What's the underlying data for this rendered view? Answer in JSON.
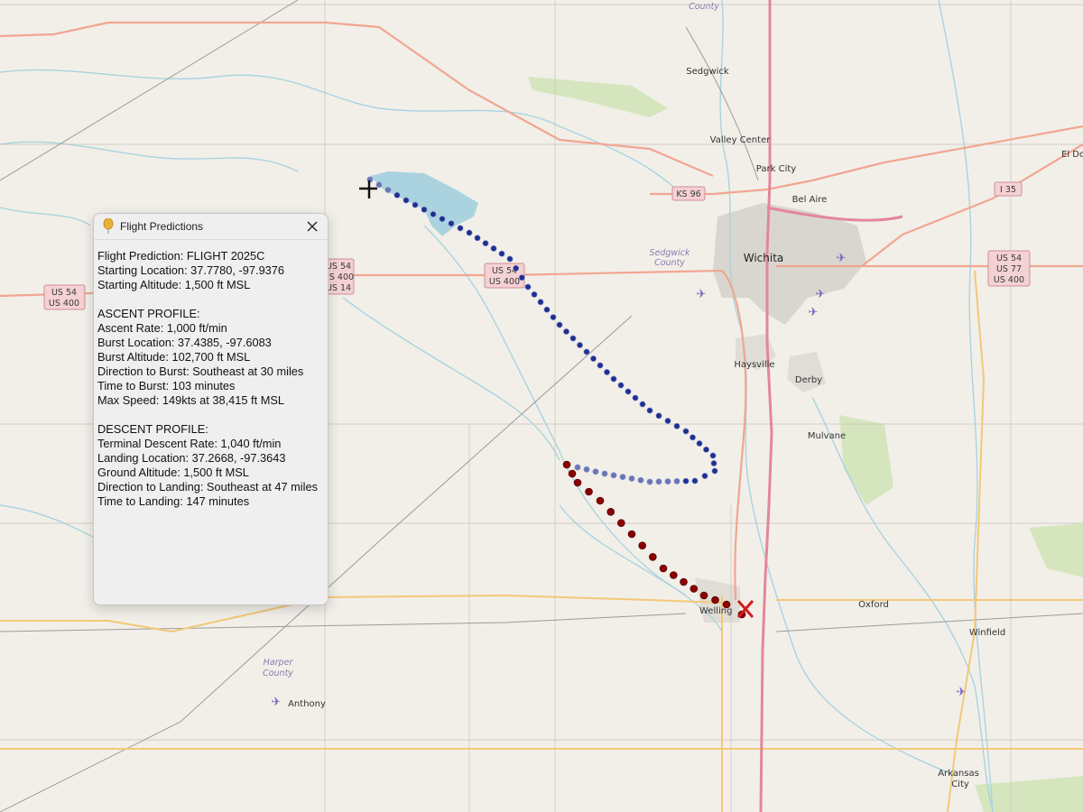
{
  "map": {
    "places": {
      "sedgwick": "Sedgwick",
      "valley_center": "Valley Center",
      "park_city": "Park City",
      "bel_aire": "Bel Aire",
      "wichita": "Wichita",
      "haysville": "Haysville",
      "derby": "Derby",
      "mulvane": "Mulvane",
      "oxford": "Oxford",
      "winfield": "Winfield",
      "anthony": "Anthony",
      "arkansas_city_1": "Arkansas",
      "arkansas_city_2": "City",
      "el_dorado": "El Do",
      "wellington": "Welling"
    },
    "counties": {
      "top": "County",
      "sedgwick_1": "Sedgwick",
      "sedgwick_2": "County",
      "harper_1": "Harper",
      "harper_2": "County"
    },
    "shields": {
      "us54_us400_left": [
        "US 54",
        "US 400"
      ],
      "us54_us400_mid": [
        "US 54",
        "US 400"
      ],
      "us54_us400_panel": [
        "US 54",
        "US 400",
        "US 14"
      ],
      "ks96": [
        "KS 96"
      ],
      "i35": [
        "I 35"
      ],
      "us54_us77_us400": [
        "US 54",
        "US 77",
        "US 400"
      ]
    },
    "airport_icon": "airplane-icon",
    "colors": {
      "background": "#f2efe9",
      "ascent_path": "#1f2f8f",
      "descent_path": "#8b0000",
      "water": "#aad3df",
      "motorway": "#e892a2",
      "trunk": "#f9b29c",
      "secondary": "#f7c86b"
    }
  },
  "panel": {
    "title": "Flight Predictions",
    "icon": "balloon-icon",
    "lines": [
      "Flight Prediction: FLIGHT 2025C",
      "Starting Location: 37.7780, -97.9376",
      "Starting Altitude: 1,500 ft MSL",
      "",
      "ASCENT PROFILE:",
      "Ascent Rate: 1,000 ft/min",
      "Burst Location: 37.4385, -97.6083",
      "Burst Altitude: 102,700 ft MSL",
      "Direction to Burst: Southeast at 30 miles",
      "Time to Burst: 103 minutes",
      "Max Speed: 149kts at 38,415 ft MSL",
      "",
      "DESCENT PROFILE:",
      "Terminal Descent Rate: 1,040 ft/min",
      "Landing Location: 37.2668, -97.3643",
      "Ground Altitude: 1,500 ft MSL",
      "Direction to Landing: Southeast at 47 miles",
      "Time to Landing: 147 minutes"
    ]
  }
}
